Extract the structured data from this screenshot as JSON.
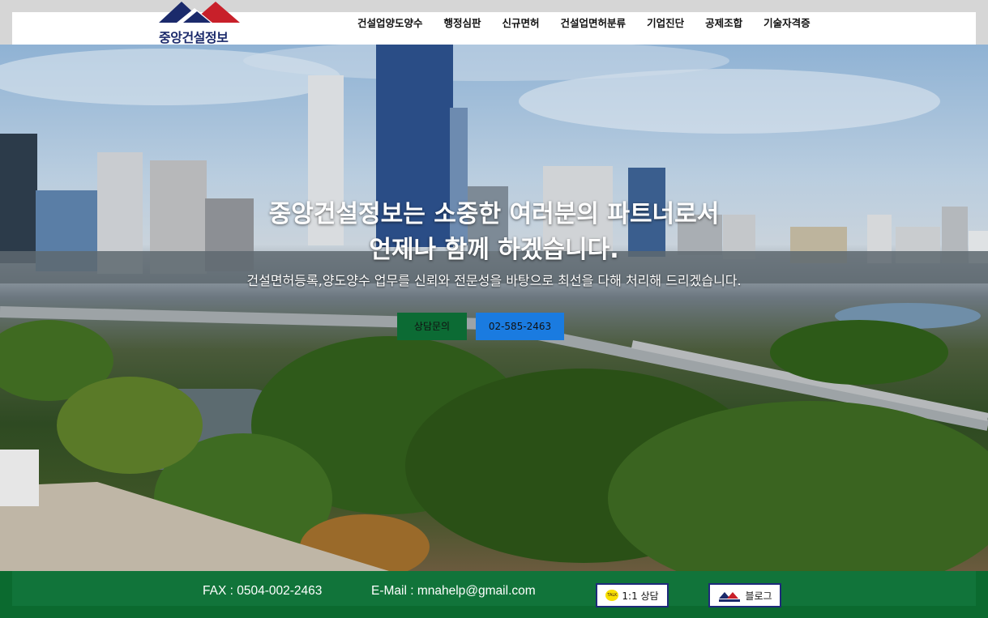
{
  "header": {
    "logo_text": "중앙건설정보",
    "nav": [
      "건설업양도양수",
      "행정심판",
      "신규면허",
      "건설업면허분류",
      "기업진단",
      "공제조합",
      "기술자격증"
    ]
  },
  "hero": {
    "title_line1": "중앙건설정보는 소중한 여러분의 파트너로서",
    "title_line2": "언제나 함께 하겠습니다.",
    "subtitle": "건설면허등록,양도양수 업무를 신뢰와 전문성을 바탕으로 최선을 다해 처리해 드리겠습니다.",
    "consult_button": "상담문의",
    "phone_button": "02-585-2463"
  },
  "footer": {
    "fax": "FAX : 0504-002-2463",
    "email": "E-Mail : mnahelp@gmail.com",
    "kakao_label": "1:1 상담",
    "kakao_icon_text": "TALK",
    "blog_label": "블로그"
  },
  "colors": {
    "footer_green": "#0b6a2f",
    "consult_green": "#0c6b34",
    "phone_blue": "#1a7be0",
    "logo_navy": "#1b2a6b",
    "logo_red": "#c8202a"
  },
  "icons": [
    "logo-mark-icon",
    "kakao-talk-icon",
    "blog-logo-icon"
  ]
}
